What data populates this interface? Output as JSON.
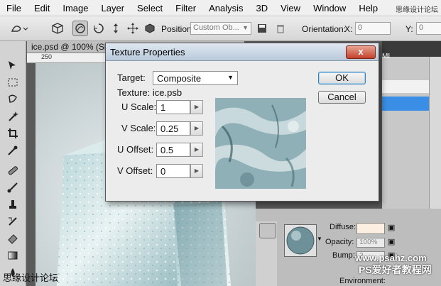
{
  "menubar": {
    "items": [
      "File",
      "Edit",
      "Image",
      "Layer",
      "Select",
      "Filter",
      "Analysis",
      "3D",
      "View",
      "Window",
      "Help"
    ],
    "watermark": "思缘设计论坛"
  },
  "options": {
    "position_label": "Position:",
    "position_value": "Custom Ob...",
    "orientation_label": "Orientation:",
    "x_label": "X:",
    "x_value": "0",
    "y_label": "Y:",
    "y_value": "0"
  },
  "document": {
    "tab_title": "ice.psd @ 100% (Sh",
    "ruler_mark": "250"
  },
  "dialog": {
    "title": "Texture Properties",
    "close_label": "x",
    "target_label": "Target:",
    "target_value": "Composite",
    "texture_label": "Texture: ice.psb",
    "fields": [
      {
        "label": "U Scale:",
        "value": "1"
      },
      {
        "label": "V Scale:",
        "value": "0.25"
      },
      {
        "label": "U Offset:",
        "value": "0.5"
      },
      {
        "label": "V Offset:",
        "value": "0"
      }
    ],
    "ok_label": "OK",
    "cancel_label": "Cancel"
  },
  "panel": {
    "tab_label": "MI",
    "diffuse_label": "Diffuse:",
    "opacity_label": "Opacity:",
    "opacity_value": "100%",
    "bump_label": "Bump:",
    "bump_value": "2",
    "environment_label": "Environment:"
  },
  "watermarks": {
    "bottom_left": "思缘设计论坛",
    "site_1": "www.psahz.com",
    "site_2": "PS爱好者教程网"
  },
  "colors": {
    "dialog_bg": "#ececec",
    "close_red": "#c2412c",
    "ok_border": "#3c7fb1",
    "selection_blue": "#3a8ee6"
  }
}
